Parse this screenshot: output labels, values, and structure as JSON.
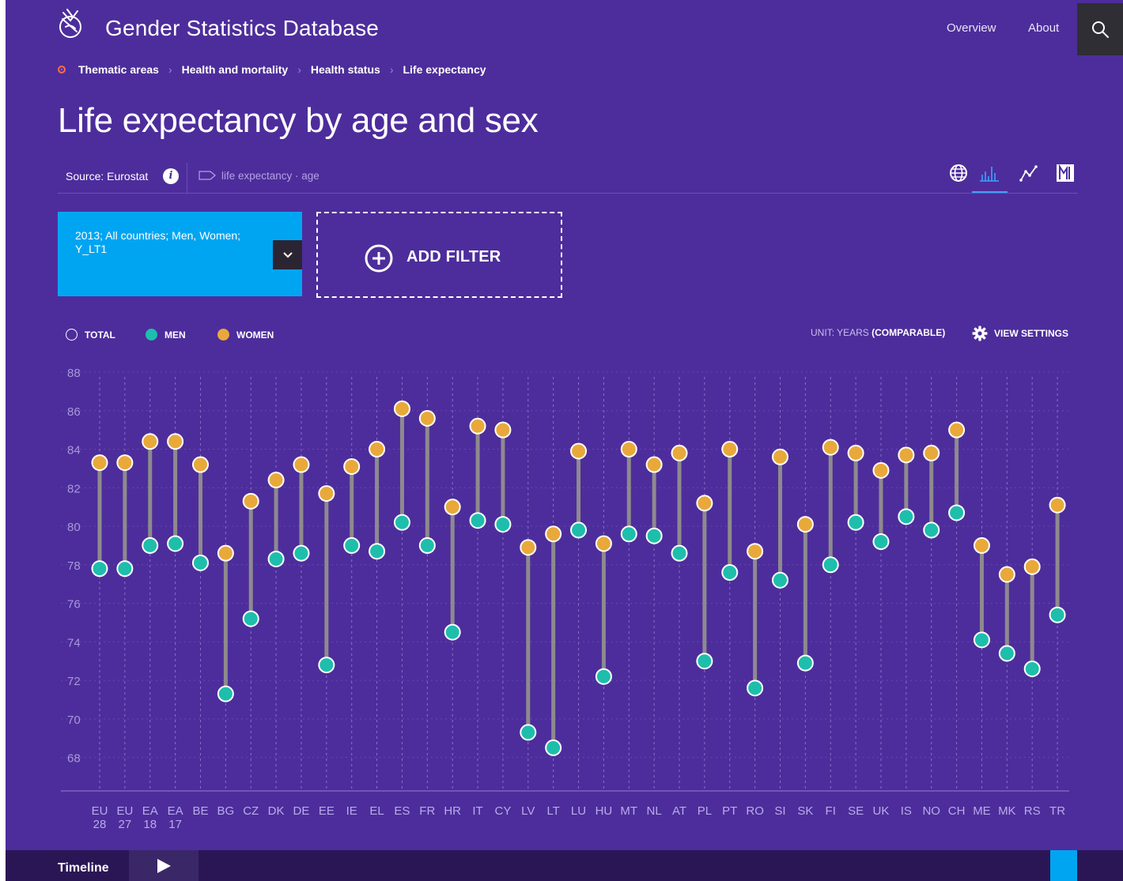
{
  "app": {
    "title": "Gender Statistics Database"
  },
  "nav": [
    {
      "label": "Overview"
    },
    {
      "label": "About"
    }
  ],
  "breadcrumb": [
    "Thematic areas",
    "Health and mortality",
    "Health status",
    "Life expectancy"
  ],
  "page": {
    "title": "Life expectancy by age and sex"
  },
  "source": {
    "label": "Source: Eurostat",
    "tags": "life expectancy  ·  age"
  },
  "view_icons": [
    "globe-icon",
    "bar-chart-icon",
    "line-chart-icon",
    "table-icon"
  ],
  "filter": {
    "summary": "2013; All countries; Men, Women; Y_LT1",
    "add_label": "ADD FILTER"
  },
  "legend": [
    {
      "label": "TOTAL",
      "color": "#4d2d9b"
    },
    {
      "label": "MEN",
      "color": "#1ebeac"
    },
    {
      "label": "WOMEN",
      "color": "#e9a93a"
    }
  ],
  "unit": {
    "prefix": "UNIT: YEARS ",
    "value": "(COMPARABLE)"
  },
  "view_settings": {
    "label": "VIEW SETTINGS"
  },
  "timeline": {
    "label": "Timeline"
  },
  "colors": {
    "background": "#4d2d9b",
    "men": "#1ebeac",
    "women": "#e9a93a",
    "accent": "#00a5f2"
  },
  "chart_data": {
    "type": "dumbbell",
    "title": "",
    "xlabel": "",
    "ylabel": "",
    "ylim": [
      66.5,
      88
    ],
    "yticks": [
      68,
      70,
      72,
      74,
      76,
      78,
      80,
      82,
      84,
      86,
      88
    ],
    "grid": true,
    "legend_position": "top-left",
    "categories": [
      [
        "EU",
        "28"
      ],
      [
        "EU",
        "27"
      ],
      [
        "EA",
        "18"
      ],
      [
        "EA",
        "17"
      ],
      [
        "BE"
      ],
      [
        "BG"
      ],
      [
        "CZ"
      ],
      [
        "DK"
      ],
      [
        "DE"
      ],
      [
        "EE"
      ],
      [
        "IE"
      ],
      [
        "EL"
      ],
      [
        "ES"
      ],
      [
        "FR"
      ],
      [
        "HR"
      ],
      [
        "IT"
      ],
      [
        "CY"
      ],
      [
        "LV"
      ],
      [
        "LT"
      ],
      [
        "LU"
      ],
      [
        "HU"
      ],
      [
        "MT"
      ],
      [
        "NL"
      ],
      [
        "AT"
      ],
      [
        "PL"
      ],
      [
        "PT"
      ],
      [
        "RO"
      ],
      [
        "SI"
      ],
      [
        "SK"
      ],
      [
        "FI"
      ],
      [
        "SE"
      ],
      [
        "UK"
      ],
      [
        "IS"
      ],
      [
        "NO"
      ],
      [
        "CH"
      ],
      [
        "ME"
      ],
      [
        "MK"
      ],
      [
        "RS"
      ],
      [
        "TR"
      ]
    ],
    "series": [
      {
        "name": "MEN",
        "values": [
          77.8,
          77.8,
          79.0,
          79.1,
          78.1,
          71.3,
          75.2,
          78.3,
          78.6,
          72.8,
          79.0,
          78.7,
          80.2,
          79.0,
          74.5,
          80.3,
          80.1,
          69.3,
          68.5,
          79.8,
          72.2,
          79.6,
          79.5,
          78.6,
          73.0,
          77.6,
          71.6,
          77.2,
          72.9,
          78.0,
          80.2,
          79.2,
          80.5,
          79.8,
          80.7,
          74.1,
          73.4,
          72.6,
          75.4
        ]
      },
      {
        "name": "WOMEN",
        "values": [
          83.3,
          83.3,
          84.4,
          84.4,
          83.2,
          78.6,
          81.3,
          82.4,
          83.2,
          81.7,
          83.1,
          84.0,
          86.1,
          85.6,
          81.0,
          85.2,
          85.0,
          78.9,
          79.6,
          83.9,
          79.1,
          84.0,
          83.2,
          83.8,
          81.2,
          84.0,
          78.7,
          83.6,
          80.1,
          84.1,
          83.8,
          82.9,
          83.7,
          83.8,
          85.0,
          79.0,
          77.5,
          77.9,
          81.1
        ]
      }
    ]
  }
}
